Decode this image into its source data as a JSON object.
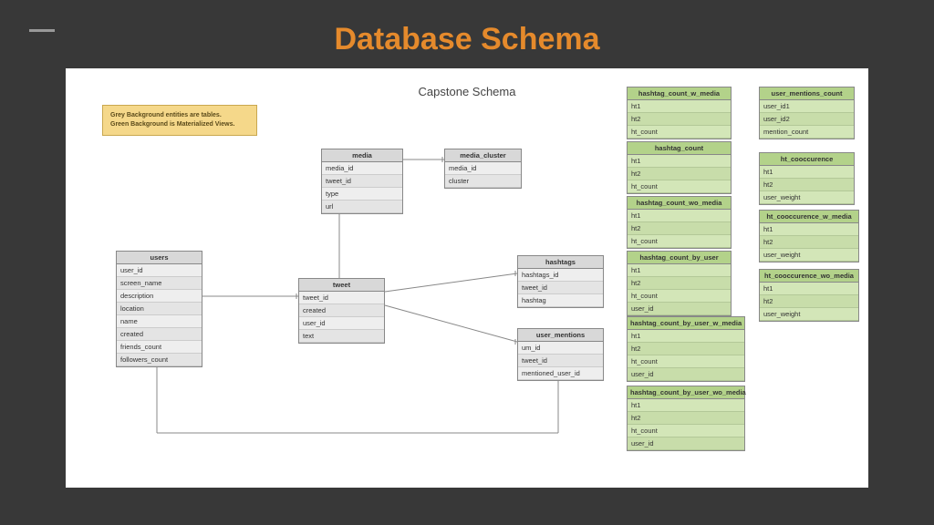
{
  "title": "Database Schema",
  "schema_title": "Capstone Schema",
  "legend": {
    "line1": "Grey Background entities are tables.",
    "line2": "Green Background is Materialized Views."
  },
  "tables": {
    "users": {
      "name": "users",
      "fields": [
        "user_id",
        "screen_name",
        "description",
        "location",
        "name",
        "created",
        "friends_count",
        "followers_count"
      ]
    },
    "tweet": {
      "name": "tweet",
      "fields": [
        "tweet_id",
        "created",
        "user_id",
        "text"
      ]
    },
    "media": {
      "name": "media",
      "fields": [
        "media_id",
        "tweet_id",
        "type",
        "url"
      ]
    },
    "media_cluster": {
      "name": "media_cluster",
      "fields": [
        "media_id",
        "cluster"
      ]
    },
    "hashtags": {
      "name": "hashtags",
      "fields": [
        "hashtags_id",
        "tweet_id",
        "hashtag"
      ]
    },
    "user_mentions": {
      "name": "user_mentions",
      "fields": [
        "um_id",
        "tweet_id",
        "mentioned_user_id"
      ]
    }
  },
  "views": {
    "hashtag_count_w_media": {
      "name": "hashtag_count_w_media",
      "fields": [
        "ht1",
        "ht2",
        "ht_count"
      ]
    },
    "hashtag_count": {
      "name": "hashtag_count",
      "fields": [
        "ht1",
        "ht2",
        "ht_count"
      ]
    },
    "hashtag_count_wo_media": {
      "name": "hashtag_count_wo_media",
      "fields": [
        "ht1",
        "ht2",
        "ht_count"
      ]
    },
    "hashtag_count_by_user": {
      "name": "hashtag_count_by_user",
      "fields": [
        "ht1",
        "ht2",
        "ht_count",
        "user_id"
      ]
    },
    "hashtag_count_by_user_w_media": {
      "name": "hashtag_count_by_user_w_media",
      "fields": [
        "ht1",
        "ht2",
        "ht_count",
        "user_id"
      ]
    },
    "hashtag_count_by_user_wo_media": {
      "name": "hashtag_count_by_user_wo_media",
      "fields": [
        "ht1",
        "ht2",
        "ht_count",
        "user_id"
      ]
    },
    "user_mentions_count": {
      "name": "user_mentions_count",
      "fields": [
        "user_id1",
        "user_id2",
        "mention_count"
      ]
    },
    "ht_cooccurence": {
      "name": "ht_cooccurence",
      "fields": [
        "ht1",
        "ht2",
        "user_weight"
      ]
    },
    "ht_cooccurence_w_media": {
      "name": "ht_cooccurence_w_media",
      "fields": [
        "ht1",
        "ht2",
        "user_weight"
      ]
    },
    "ht_cooccurence_wo_media": {
      "name": "ht_cooccurence_wo_media",
      "fields": [
        "ht1",
        "ht2",
        "user_weight"
      ]
    }
  }
}
